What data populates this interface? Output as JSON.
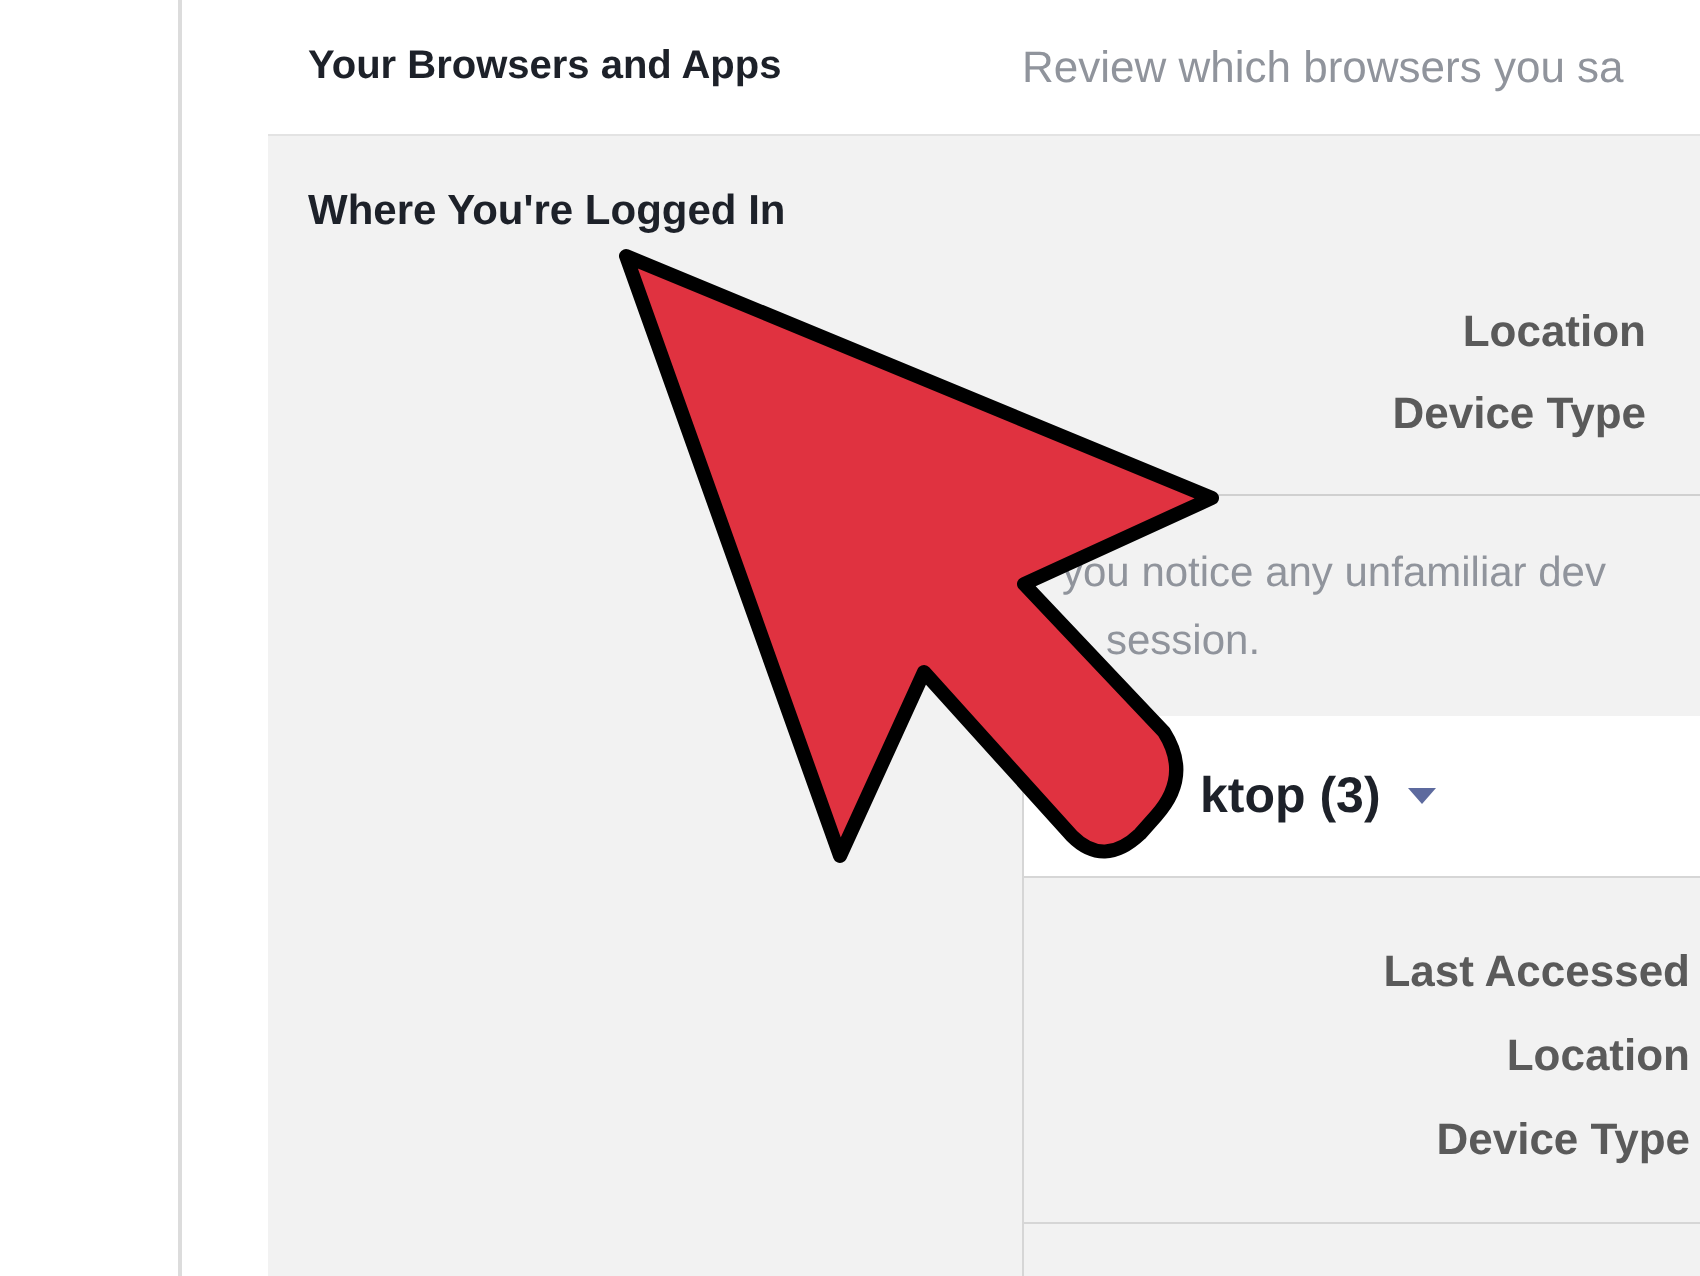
{
  "browsers_row": {
    "title": "Your Browsers and Apps",
    "description": "Review which browsers you sa"
  },
  "logged_in": {
    "title": "Where You're Logged In",
    "current_session": {
      "labels": [
        "Location",
        "Device Type"
      ]
    },
    "notice": [
      "you notice any unfamiliar dev",
      "session."
    ],
    "group": {
      "title": "ktop (3)",
      "expanded": true,
      "labels": [
        "Last Accessed",
        "Location",
        "Device Type"
      ]
    }
  }
}
